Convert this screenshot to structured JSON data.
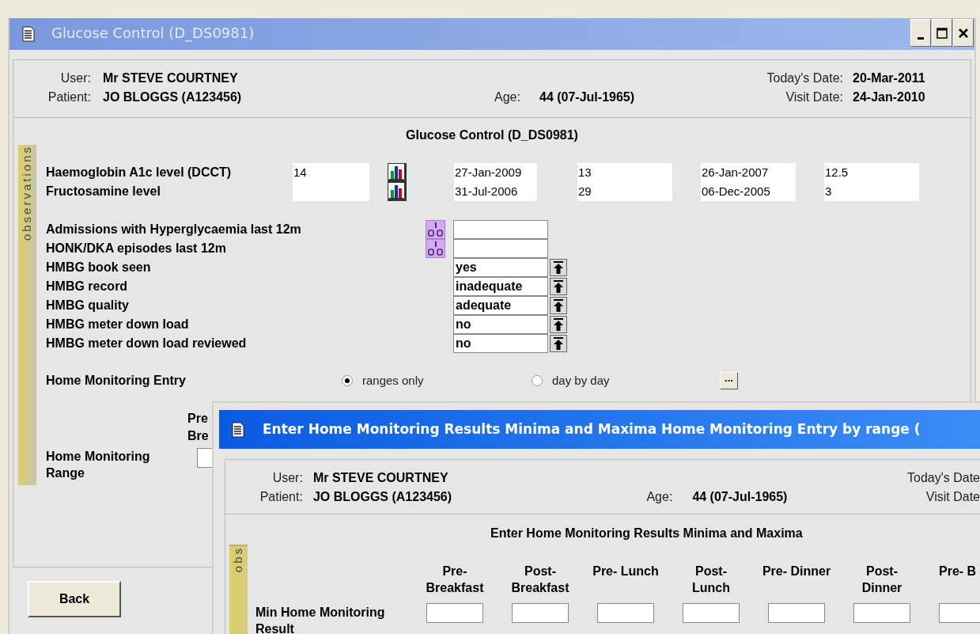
{
  "window": {
    "title": "Glucose Control (D_DS0981)"
  },
  "header": {
    "user_label": "User:",
    "user": "Mr STEVE COURTNEY",
    "patient_label": "Patient:",
    "patient": "JO BLOGGS (A123456)",
    "age_label": "Age:",
    "age": "44 (07-Jul-1965)",
    "todays_date_label": "Today's Date:",
    "todays_date": "20-Mar-2011",
    "visit_date_label": "Visit Date:",
    "visit_date": "24-Jan-2010"
  },
  "section_title": "Glucose Control (D_DS0981)",
  "side_tab": "observations",
  "readings": [
    {
      "label": "Haemoglobin A1c level (DCCT)",
      "value": "14",
      "date_1": "27-Jan-2009",
      "value_1": "13",
      "date_2": "26-Jan-2007",
      "value_2": "12.5"
    },
    {
      "label": "Fructosamine level",
      "date_1": "31-Jul-2006",
      "value_1": "29",
      "date_2": "06-Dec-2005",
      "value_2": "3"
    }
  ],
  "fields": [
    {
      "kind": "count",
      "label": "Admissions with Hyperglycaemia last 12m"
    },
    {
      "kind": "count",
      "label": "HONK/DKA episodes last 12m"
    },
    {
      "kind": "choice",
      "label": "HMBG book seen",
      "value": "yes"
    },
    {
      "kind": "choice",
      "label": "HMBG record",
      "value": "inadequate"
    },
    {
      "kind": "choice",
      "label": "HMBG quality",
      "value": "adequate"
    },
    {
      "kind": "choice",
      "label": "HMBG meter down load",
      "value": "no"
    },
    {
      "kind": "choice",
      "label": "HMBG meter down load reviewed",
      "value": "no"
    }
  ],
  "entry_mode": {
    "label": "Home Monitoring Entry",
    "options": [
      {
        "label": "ranges only",
        "selected": true
      },
      {
        "label": "day by day",
        "selected": false
      }
    ],
    "more_button": "..."
  },
  "range": {
    "label": "Home Monitoring\nRange",
    "column_1": "Pre\nBre"
  },
  "buttons": [
    "Back"
  ],
  "dialog": {
    "title": "Enter Home Monitoring Results Minima and Maxima Home Monitoring Entry by range (",
    "header": {
      "user_label": "User:",
      "user": "Mr STEVE COURTNEY",
      "patient_label": "Patient:",
      "patient": "JO BLOGGS (A123456)",
      "age_label": "Age:",
      "age": "44 (07-Jul-1965)",
      "todays_date_label": "Today's Date",
      "visit_date_label": "Visit Date"
    },
    "section_title": "Enter Home Monitoring Results Minima and Maxima",
    "side_tab": "obs",
    "columns": [
      "Pre-\nBreakfast",
      "Post-\nBreakfast",
      "Pre- Lunch",
      "Post-\nLunch",
      "Pre- Dinner",
      "Post-\nDinner",
      "Pre- B"
    ],
    "row_label": "Min Home Monitoring\nResult"
  }
}
